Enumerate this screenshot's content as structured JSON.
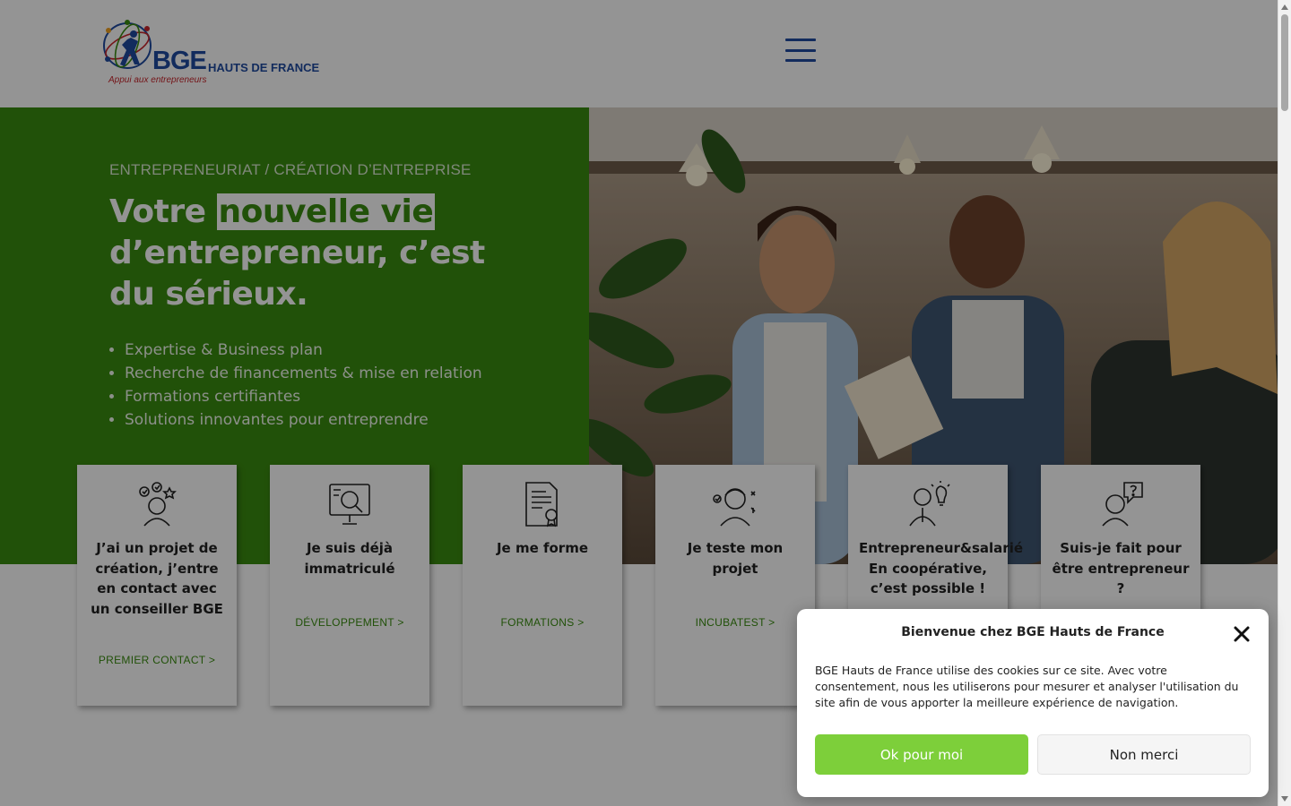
{
  "header": {
    "logo_main": "BGE",
    "logo_region": "HAUTS DE FRANCE",
    "logo_tagline": "Appui aux entrepreneurs",
    "menu_icon": "hamburger-menu-icon"
  },
  "hero": {
    "kicker": "ENTREPRENEURIAT / CRÉATION D’ENTREPRISE",
    "headline_prefix": "Votre ",
    "headline_highlight": "nouvelle vie",
    "headline_suffix": " d’entrepreneur, c’est du sérieux.",
    "bullets": [
      "Expertise & Business plan",
      "Recherche de financements & mise en relation",
      "Formations certifiantes",
      "Solutions innovantes pour entreprendre"
    ]
  },
  "cards": [
    {
      "title": "J’ai un projet de création, j’entre en contact avec un conseiller BGE",
      "link": "PREMIER CONTACT >",
      "icon": "person-ideas-icon"
    },
    {
      "title": "Je suis déjà immatriculé",
      "link": "DÉVELOPPEMENT >",
      "icon": "presentation-board-icon"
    },
    {
      "title": "Je me forme",
      "link": "FORMATIONS >",
      "icon": "certificate-document-icon"
    },
    {
      "title": "Je teste mon projet",
      "link": "INCUBATEST >",
      "icon": "person-thinking-icon"
    },
    {
      "title": "Entrepreneur&salarié",
      "subtitle": "En coopérative, c’est possible !",
      "link": "",
      "icon": "entrepreneur-lightbulb-icon"
    },
    {
      "title": "Suis-je fait pour être entrepreneur ?",
      "link": "",
      "icon": "person-question-icon"
    }
  ],
  "cookie": {
    "title": "Bienvenue chez BGE Hauts de France",
    "text": "BGE Hauts de France utilise des cookies sur ce site. Avec votre consentement, nous les utiliserons pour mesurer et analyser l'utilisation du site afin de vous apporter la meilleure expérience de navigation.",
    "accept_label": "Ok pour moi",
    "deny_label": "Non merci",
    "close_icon": "close-icon"
  },
  "colors": {
    "brand_green": "#3a8c10",
    "accept_green": "#7dcf3a",
    "logo_blue": "#1f4aa0",
    "logo_red": "#c8252c"
  }
}
